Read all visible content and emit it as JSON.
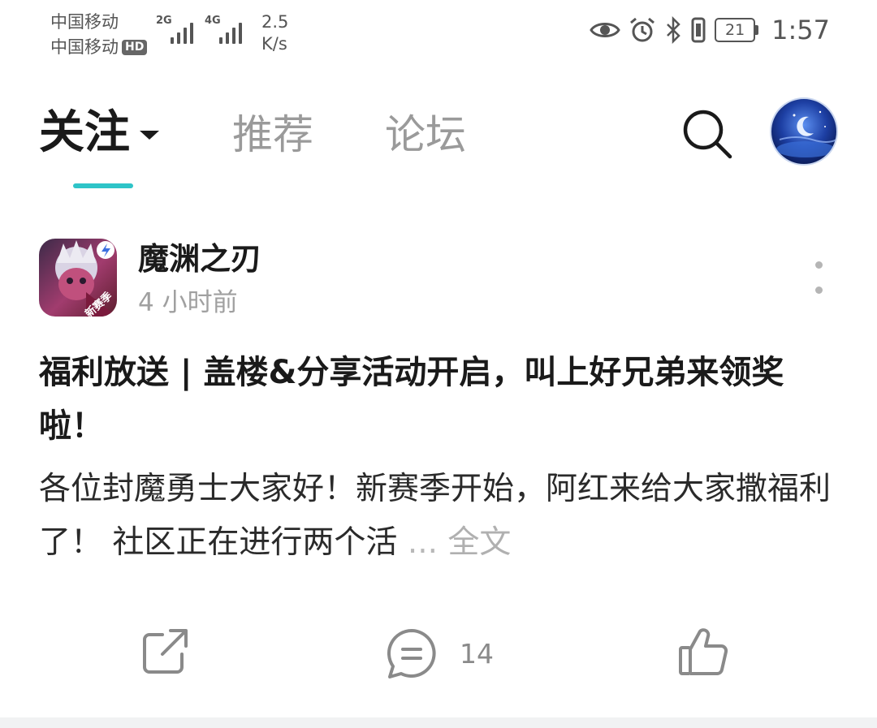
{
  "status_bar": {
    "carrier_1": "中国移动",
    "carrier_2": "中国移动",
    "hd_badge": "HD",
    "signal_1_label": "2G",
    "signal_2_label": "4G",
    "net_speed_value": "2.5",
    "net_speed_unit": "K/s",
    "battery_level": "21",
    "time": "1:57",
    "icons": [
      "eye-icon",
      "alarm-icon",
      "bluetooth-icon",
      "vibrate-icon",
      "battery-icon"
    ]
  },
  "nav": {
    "tabs": [
      {
        "label": "关注",
        "active": true
      },
      {
        "label": "推荐",
        "active": false
      },
      {
        "label": "论坛",
        "active": false
      }
    ],
    "accent_color": "#2ec4c8",
    "search_icon": "search-icon",
    "avatar_icon": "user-avatar"
  },
  "post": {
    "author": "魔渊之刃",
    "time_ago": "4 小时前",
    "title": "福利放送 | 盖楼&分享活动开启，叫上好兄弟来领奖啦！",
    "excerpt": "各位封魔勇士大家好！新赛季开始，阿红来给大家撒福利了！  社区正在进行两个活",
    "ellipsis": "...",
    "read_full": "全文",
    "game_icon_badge": "新赛季"
  },
  "actions": {
    "share_icon": "share-icon",
    "comment_icon": "comment-icon",
    "comment_count": "14",
    "like_icon": "thumbs-up-icon"
  }
}
